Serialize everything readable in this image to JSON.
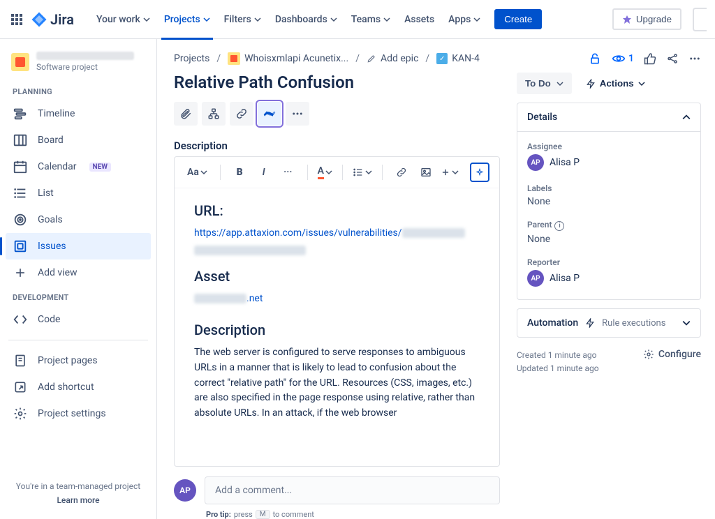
{
  "topnav": {
    "logo_text": "Jira",
    "items": [
      {
        "label": "Your work"
      },
      {
        "label": "Projects",
        "active": true
      },
      {
        "label": "Filters"
      },
      {
        "label": "Dashboards"
      },
      {
        "label": "Teams"
      },
      {
        "label": "Assets",
        "no_chevron": true
      },
      {
        "label": "Apps"
      }
    ],
    "create": "Create",
    "upgrade": "Upgrade"
  },
  "sidebar": {
    "project_type": "Software project",
    "section_planning": "PLANNING",
    "planning_items": [
      {
        "label": "Timeline",
        "name": "sidebar-item-timeline"
      },
      {
        "label": "Board",
        "name": "sidebar-item-board"
      },
      {
        "label": "Calendar",
        "name": "sidebar-item-calendar",
        "badge": "NEW"
      },
      {
        "label": "List",
        "name": "sidebar-item-list"
      },
      {
        "label": "Goals",
        "name": "sidebar-item-goals"
      },
      {
        "label": "Issues",
        "name": "sidebar-item-issues",
        "selected": true
      },
      {
        "label": "Add view",
        "name": "sidebar-item-add-view"
      }
    ],
    "section_development": "DEVELOPMENT",
    "dev_items": [
      {
        "label": "Code",
        "name": "sidebar-item-code"
      }
    ],
    "bottom_items": [
      {
        "label": "Project pages",
        "name": "sidebar-item-project-pages"
      },
      {
        "label": "Add shortcut",
        "name": "sidebar-item-add-shortcut"
      },
      {
        "label": "Project settings",
        "name": "sidebar-item-project-settings"
      }
    ],
    "footer_text": "You're in a team-managed project",
    "footer_link": "Learn more"
  },
  "breadcrumb": {
    "projects": "Projects",
    "project_name": "Whoisxmlapi Acunetix...",
    "add_epic": "Add epic",
    "issue_key": "KAN-4",
    "watch_count": "1"
  },
  "issue": {
    "title": "Relative Path Confusion",
    "description_label": "Description",
    "url_heading": "URL:",
    "url_link": "https://app.attaxion.com/issues/vulnerabilities/",
    "asset_heading": "Asset",
    "asset_link_suffix": ".net",
    "inner_desc_heading": "Description",
    "inner_desc_body": "The web server is configured to serve responses to ambiguous URLs in a manner that is likely to lead to confusion about the correct \"relative path\" for the URL. Resources (CSS, images, etc.) are also specified in the page response using relative, rather than absolute URLs. In an attack, if the web browser"
  },
  "side_panel": {
    "status": "To Do",
    "actions": "Actions",
    "details": "Details",
    "assignee_label": "Assignee",
    "assignee_name": "Alisa P",
    "assignee_initials": "AP",
    "labels_label": "Labels",
    "labels_value": "None",
    "parent_label": "Parent",
    "parent_value": "None",
    "reporter_label": "Reporter",
    "reporter_name": "Alisa P",
    "reporter_initials": "AP",
    "automation_label": "Automation",
    "automation_text": "Rule executions",
    "created": "Created 1 minute ago",
    "updated": "Updated 1 minute ago",
    "configure": "Configure"
  },
  "comment": {
    "avatar_initials": "AP",
    "placeholder": "Add a comment...",
    "protip_label": "Pro tip:",
    "protip_press": "press",
    "protip_key": "M",
    "protip_rest": "to comment"
  }
}
